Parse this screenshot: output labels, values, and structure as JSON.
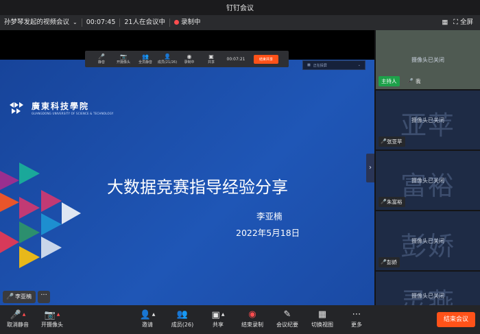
{
  "window": {
    "title": "钉钉会议"
  },
  "infobar": {
    "meeting_name": "孙梦琴发起的视频会议",
    "elapsed": "00:07:45",
    "participants_in_meeting": "21人在会议中",
    "recording": "录制中",
    "fullscreen": "全屏"
  },
  "share_toolbar": {
    "items": [
      "静音",
      "开摄像头",
      "全员静音",
      "成员(21/26)",
      "录制中",
      "共享"
    ],
    "time": "00:07:21",
    "end_share": "结束共享",
    "projector": "正在投屏"
  },
  "slide": {
    "school_name": "廣東科技學院",
    "school_en": "GUANGDONG UNIVERSITY OF SCIENCE & TECHNOLOGY",
    "title": "大数据竞赛指导经验分享",
    "author": "李亚楠",
    "date": "2022年5月18日",
    "triangle_colors": [
      "#1aa89a",
      "#d83a5a",
      "#e9552b",
      "#2c8f6e",
      "#9a2f8f",
      "#e8b81a",
      "#c23a74",
      "#1d8fd0"
    ]
  },
  "stage": {
    "speaker": "李亚楠",
    "more": "···"
  },
  "participants": [
    {
      "name": "我",
      "host_label": "主持人",
      "camera": "摄像头已关闭",
      "bg": ""
    },
    {
      "name": "张亚苹",
      "camera": "摄像头已关闭",
      "bg": "亚苹"
    },
    {
      "name": "朱富裕",
      "camera": "摄像头已关闭",
      "bg": "富裕"
    },
    {
      "name": "彭娇",
      "camera": "摄像头已关闭",
      "bg": "彭娇"
    },
    {
      "name": "",
      "camera": "摄像头已关闭",
      "bg": "灵燕"
    }
  ],
  "bottombar": {
    "unmute": "取消静音",
    "camera": "开摄像头",
    "invite": "邀请",
    "members": "成员(26)",
    "share": "共享",
    "end_record": "结束录制",
    "minutes": "会议纪要",
    "switch_view": "切换视图",
    "more": "更多",
    "end_meeting": "结束会议"
  },
  "colors": {
    "accent_end": "#ff5219",
    "record_red": "#ff4d4f",
    "host_green": "#1ea14a"
  }
}
